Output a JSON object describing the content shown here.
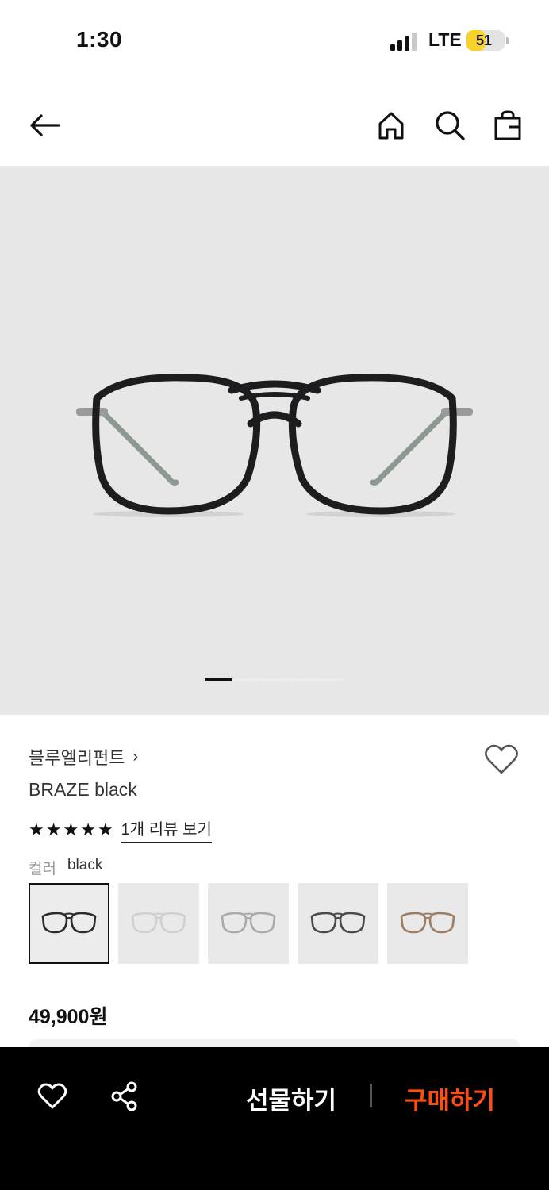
{
  "status_bar": {
    "time": "1:30",
    "network": "LTE",
    "battery": "51",
    "battery_level": 0.51
  },
  "header": {
    "icons": [
      "back-arrow-icon",
      "home-icon",
      "search-icon",
      "shopping-bag-icon"
    ]
  },
  "hero": {
    "image": "black aviator eyeglasses frame",
    "page_index": 1,
    "page_count": 5
  },
  "product": {
    "brand": "블루엘리펀트",
    "brand_chevron": "›",
    "name": "BRAZE black",
    "rating_stars": 5,
    "review_link": "1개 리뷰 보기",
    "color_label": "컬러",
    "color_value": "black",
    "swatches": [
      {
        "color": "black",
        "frame_hex": "#2b2b2b"
      },
      {
        "color": "clear",
        "frame_hex": "#cfcfcf"
      },
      {
        "color": "grey crystal",
        "frame_hex": "#a9a9a9"
      },
      {
        "color": "dark grey",
        "frame_hex": "#4a4a4a"
      },
      {
        "color": "brown",
        "frame_hex": "#9b7d64"
      }
    ],
    "price": "49,900원"
  },
  "bottom_bar": {
    "gift_label": "선물하기",
    "buy_label": "구매하기",
    "buy_color": "#ff4d12"
  }
}
